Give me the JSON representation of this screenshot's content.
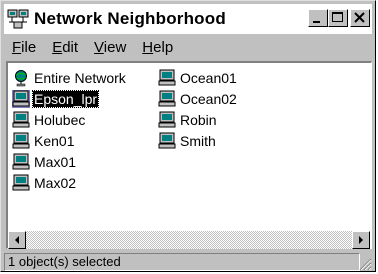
{
  "window": {
    "title": "Network Neighborhood"
  },
  "menu": [
    {
      "label": "File",
      "accel": "F",
      "rest": "ile"
    },
    {
      "label": "Edit",
      "accel": "E",
      "rest": "dit"
    },
    {
      "label": "View",
      "accel": "V",
      "rest": "iew"
    },
    {
      "label": "Help",
      "accel": "H",
      "rest": "elp"
    }
  ],
  "items": {
    "col1": [
      {
        "label": "Entire Network",
        "icon": "entire-network-icon",
        "selected": false
      },
      {
        "label": "Epson_lpr",
        "icon": "computer-icon",
        "selected": true
      },
      {
        "label": "Holubec",
        "icon": "computer-icon",
        "selected": false
      },
      {
        "label": "Ken01",
        "icon": "computer-icon",
        "selected": false
      },
      {
        "label": "Max01",
        "icon": "computer-icon",
        "selected": false
      },
      {
        "label": "Max02",
        "icon": "computer-icon",
        "selected": false
      }
    ],
    "col2": [
      {
        "label": "Ocean01",
        "icon": "computer-icon",
        "selected": false
      },
      {
        "label": "Ocean02",
        "icon": "computer-icon",
        "selected": false
      },
      {
        "label": "Robin",
        "icon": "computer-icon",
        "selected": false
      },
      {
        "label": "Smith",
        "icon": "computer-icon",
        "selected": false
      }
    ]
  },
  "status": {
    "text": "1 object(s) selected"
  }
}
